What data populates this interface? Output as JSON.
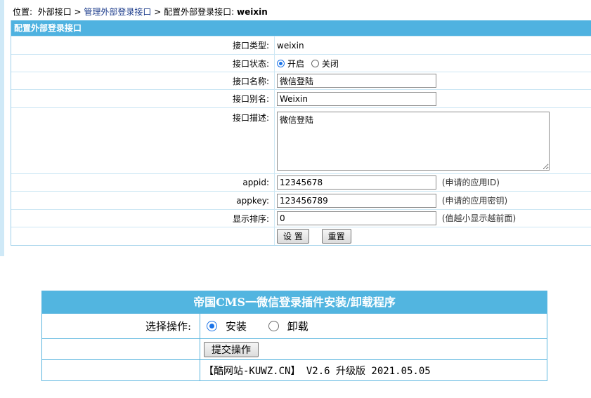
{
  "breadcrumb": {
    "prefix": "位置:",
    "item1": "外部接口",
    "sep": ">",
    "item2": "管理外部登录接口",
    "item3": "配置外部登录接口:",
    "current": "weixin"
  },
  "config": {
    "title": "配置外部登录接口",
    "type_label": "接口类型:",
    "type_value": "weixin",
    "status_label": "接口状态:",
    "status_on": "开启",
    "status_off": "关闭",
    "status_selected": "开启",
    "name_label": "接口名称:",
    "name_value": "微信登陆",
    "alias_label": "接口别名:",
    "alias_value": "Weixin",
    "desc_label": "接口描述:",
    "desc_value": "微信登陆",
    "appid_label": "appid:",
    "appid_value": "12345678",
    "appid_hint": "(申请的应用ID)",
    "appkey_label": "appkey:",
    "appkey_value": "123456789",
    "appkey_hint": "(申请的应用密钥)",
    "order_label": "显示排序:",
    "order_value": "0",
    "order_hint": "(值越小显示越前面)",
    "submit_label": "设 置",
    "reset_label": "重置"
  },
  "installer": {
    "title": "帝国CMS一微信登录插件安装/卸载程序",
    "op_label": "选择操作:",
    "install": "安装",
    "uninstall": "卸载",
    "selected": "安装",
    "submit_label": "提交操作",
    "version": "【酷网站-KUWZ.CN】 V2.6 升级版 2021.05.05"
  },
  "colors": {
    "header_blue": "#4fb2e0",
    "border_blue": "#5bb6df",
    "radio_blue": "#1a73e8"
  }
}
